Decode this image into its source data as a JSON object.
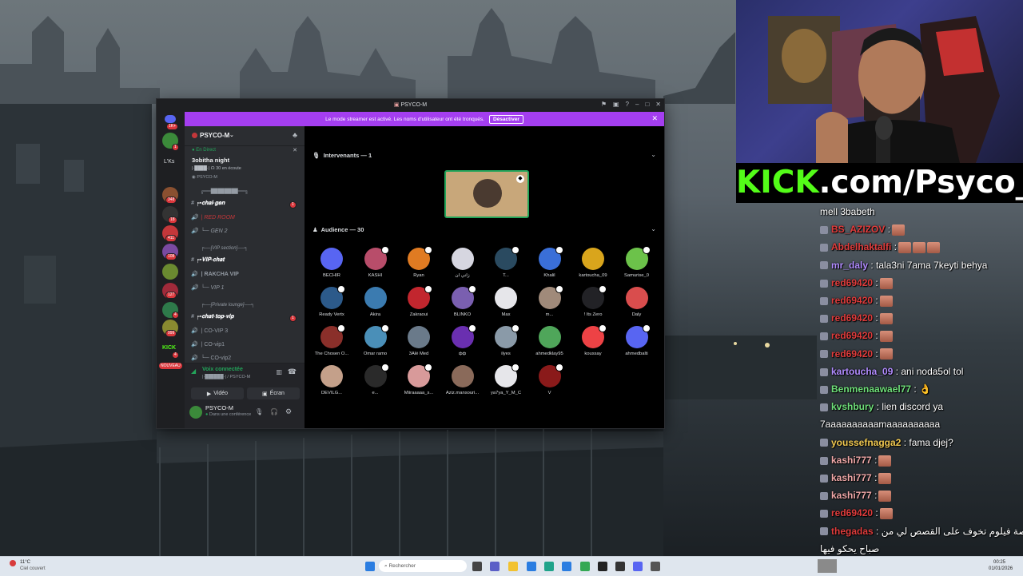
{
  "discord": {
    "window_title": "PSYCO-M",
    "streamer_banner": {
      "text": "Le mode streamer est activé. Les noms d'utilisateur ont été tronqués.",
      "button": "Désactiver"
    },
    "guild_badges": [
      "1K+",
      "1",
      "348",
      "18",
      "411",
      "108",
      "127",
      "4",
      "999",
      "4"
    ],
    "guild_labels": {
      "lks": "L'Ks",
      "kick": "KICK",
      "nouveau": "NOUVEAU"
    },
    "server_name": "PSYCO-M",
    "live": {
      "status": "En Direct",
      "title": "3obitha night",
      "channel": "|·████·|",
      "viewers": "30 en écoute",
      "host": "PSYCO-M"
    },
    "channels": [
      {
        "type": "category",
        "label": "╔══████████══╗"
      },
      {
        "type": "text",
        "label": "╒▪𝐜𝐡𝐚𝐥-𝐠𝐞𝐧",
        "unread": "1"
      },
      {
        "type": "voice",
        "label": "| RED ROOM"
      },
      {
        "type": "voice",
        "label": "└─ GEN 2"
      },
      {
        "type": "category",
        "label": "╒──[VIP section]──╕"
      },
      {
        "type": "text",
        "label": "╒▪𝐕𝐈𝐏-𝐜𝐡𝐚𝐭"
      },
      {
        "type": "voice",
        "label": "| RAKCHA VIP"
      },
      {
        "type": "voice",
        "label": "└─ VIP 1"
      },
      {
        "type": "category",
        "label": "╒──[Private lounge]──╕"
      },
      {
        "type": "text",
        "label": "╒▪𝐜𝐡𝐚𝐭-𝐭𝐨𝐩-𝐯𝐢𝐩",
        "unread": "1"
      },
      {
        "type": "voice",
        "label": "| CO-VIP 3"
      },
      {
        "type": "voice",
        "label": "| CO-vip1"
      },
      {
        "type": "voice",
        "label": "└─ CO-vip2"
      }
    ],
    "voice": {
      "status": "Voix connectée",
      "channel": "|·██████·| / PSYCO-M",
      "video_label": "Vidéo",
      "screen_label": "Écran"
    },
    "user": {
      "name": "PSYCO-M",
      "status": "Dans une conférence"
    },
    "speakers_header": "Intervenants — 1",
    "audience_header": "Audience — 30",
    "audience": [
      {
        "name": "BECHIR",
        "color": "#5865f2"
      },
      {
        "name": "KASHI",
        "color": "#b84d6a"
      },
      {
        "name": "Ryan",
        "color": "#e07b22"
      },
      {
        "name": "زاني ان",
        "color": "#d6d6e0"
      },
      {
        "name": "T...",
        "color": "#2a4a60"
      },
      {
        "name": "Khalil",
        "color": "#3a6fd8"
      },
      {
        "name": "kartoucha_09",
        "color": "#d9a51c"
      },
      {
        "name": "Samurise_0",
        "color": "#6cc24a"
      },
      {
        "name": "Ready Vertx",
        "color": "#2c5a8a"
      },
      {
        "name": "Akira",
        "color": "#3b7bb0"
      },
      {
        "name": "Zakraoui",
        "color": "#c2262e"
      },
      {
        "name": "BLINKO",
        "color": "#7a5fb0"
      },
      {
        "name": "Max",
        "color": "#e6e6ea"
      },
      {
        "name": "m...",
        "color": "#a08a7a"
      },
      {
        "name": "! Its Zero",
        "color": "#222226"
      },
      {
        "name": "Daly",
        "color": "#d94d4d"
      },
      {
        "name": "The Chosen O...",
        "color": "#8a2f2a"
      },
      {
        "name": "Omar ramo",
        "color": "#4a8fb8"
      },
      {
        "name": "3Alé Med",
        "color": "#6a7a8a"
      },
      {
        "name": "фф",
        "color": "#6a2fb0"
      },
      {
        "name": "ilyes",
        "color": "#8a9aa8"
      },
      {
        "name": "ahmedklay95",
        "color": "#4fa65a"
      },
      {
        "name": "koussay",
        "color": "#ed4245"
      },
      {
        "name": "ahmedbalti",
        "color": "#5865f2"
      },
      {
        "name": "DEVILG...",
        "color": "#c4a08a"
      },
      {
        "name": "e...",
        "color": "#2a2a2a"
      },
      {
        "name": "Miiraaaaa_s...",
        "color": "#d89a9a"
      },
      {
        "name": "Aziz.mansouri...",
        "color": "#8a6a5a"
      },
      {
        "name": "ya7ya_Y_M_C",
        "color": "#e6e6ea"
      },
      {
        "name": "V",
        "color": "#8a1a1a"
      }
    ]
  },
  "stream": {
    "kick_brand": "KICK",
    "kick_url": ".com/Psyco_M",
    "chat": [
      {
        "user": "",
        "msg": "mell 3babeth",
        "color": "#ffffff",
        "emotes": 0
      },
      {
        "user": "BS_AZIZOV",
        "msg": ":",
        "color": "#e03c3c",
        "emotes": 1
      },
      {
        "user": "Abdelhaktalfi",
        "msg": ":",
        "color": "#e03c3c",
        "emotes": 3
      },
      {
        "user": "mr_daly",
        "msg": ": tala3ni 7ama 7keyti behya",
        "color": "#b18cff",
        "emotes": 0
      },
      {
        "user": "red69420",
        "msg": ":",
        "color": "#e03c3c",
        "emotes": 1
      },
      {
        "user": "red69420",
        "msg": ":",
        "color": "#e03c3c",
        "emotes": 1
      },
      {
        "user": "red69420",
        "msg": ":",
        "color": "#e03c3c",
        "emotes": 1
      },
      {
        "user": "red69420",
        "msg": ":",
        "color": "#e03c3c",
        "emotes": 1
      },
      {
        "user": "red69420",
        "msg": ":",
        "color": "#e03c3c",
        "emotes": 1
      },
      {
        "user": "kartoucha_09",
        "msg": ": ani noda5ol tol",
        "color": "#b18cff",
        "emotes": 0
      },
      {
        "user": "Benmenaawael77",
        "msg": ": 👌",
        "color": "#6fe07a",
        "emotes": 0
      },
      {
        "user": "kvshbury",
        "msg": ": lien discord ya",
        "color": "#6fe07a",
        "emotes": 0
      },
      {
        "user": "",
        "msg": "7aaaaaaaaaamaaaaaaaaaa",
        "color": "#ffffff",
        "emotes": 0
      },
      {
        "user": "youssefnagga2",
        "msg": ": fama djej?",
        "color": "#f0c850",
        "emotes": 0
      },
      {
        "user": "kashi777",
        "msg": ":",
        "color": "#f0a8a8",
        "emotes": 1
      },
      {
        "user": "kashi777",
        "msg": ":",
        "color": "#f0a8a8",
        "emotes": 1
      },
      {
        "user": "kashi777",
        "msg": ":",
        "color": "#f0a8a8",
        "emotes": 1
      },
      {
        "user": "red69420",
        "msg": ":",
        "color": "#e03c3c",
        "emotes": 1
      },
      {
        "user": "thegadas",
        "msg": ": قصة فيلوم تخوف على القصص لي من",
        "color": "#e03c3c",
        "emotes": 0
      },
      {
        "user": "",
        "msg": "صباح يحكو فيها",
        "color": "#ffffff",
        "emotes": 0
      }
    ]
  },
  "taskbar": {
    "weather_temp": "11°C",
    "weather_desc": "Ciel couvert",
    "search_placeholder": "Rechercher",
    "time": "00:25",
    "date": "01/01/2026"
  }
}
